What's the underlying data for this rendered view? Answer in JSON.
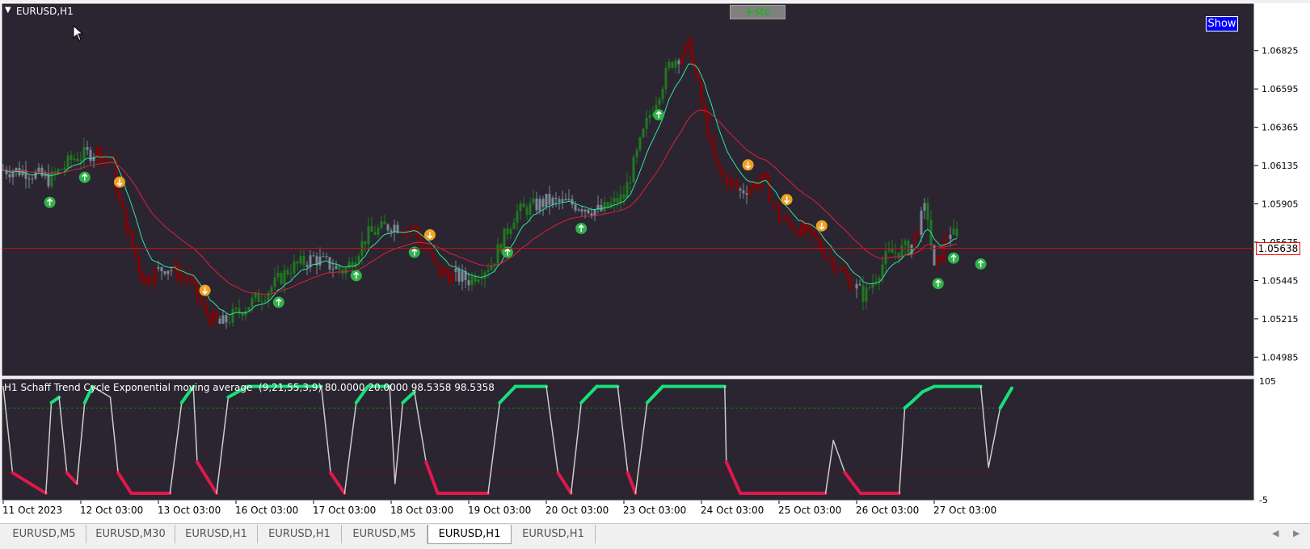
{
  "window": {
    "symbol_title": "EURUSD,H1",
    "stc_button_label": "+stc",
    "show_button_label": "Show",
    "indicator_label": "H1 Schaff Trend Cycle Exponential moving average  (9,21,55,3,9) 80.0000 20.0000 98.5358 98.5358",
    "current_price_label": "1.05638",
    "current_price": 1.05638
  },
  "colors": {
    "background": "#2a2530",
    "axis_area": "#ffffff",
    "bull_candle": "#1f7a1f",
    "bear_candle": "#8b0000",
    "neutral_candle": "#7c8796",
    "fast_ma": "#2ee6a0",
    "slow_ma": "#e0203c",
    "buy_arrow": "#2fb34a",
    "sell_arrow": "#f0a020",
    "price_line": "#c81414",
    "stc_up": "#18e07a",
    "stc_down": "#e0184c",
    "stc_neutral": "#cccccc",
    "level_80": "#1f7a1f",
    "level_20": "#8b0000"
  },
  "tabs": [
    {
      "label": "EURUSD,M5",
      "active": false
    },
    {
      "label": "EURUSD,M30",
      "active": false
    },
    {
      "label": "EURUSD,H1",
      "active": false
    },
    {
      "label": "EURUSD,H1",
      "active": false
    },
    {
      "label": "EURUSD,M5",
      "active": false
    },
    {
      "label": "EURUSD,H1",
      "active": true
    },
    {
      "label": "EURUSD,H1",
      "active": false
    }
  ],
  "chart_data": [
    {
      "type": "candlestick",
      "title": "EURUSD,H1",
      "y_ticks": [
        "1.06825",
        "1.06595",
        "1.06365",
        "1.06135",
        "1.05905",
        "1.05675",
        "1.05445",
        "1.05215",
        "1.04985"
      ],
      "ylim": [
        1.0488,
        1.071
      ],
      "x_ticks": [
        "11 Oct 2023",
        "12 Oct 03:00",
        "13 Oct 03:00",
        "16 Oct 03:00",
        "17 Oct 03:00",
        "18 Oct 03:00",
        "19 Oct 03:00",
        "20 Oct 03:00",
        "23 Oct 03:00",
        "24 Oct 03:00",
        "25 Oct 03:00",
        "26 Oct 03:00",
        "27 Oct 03:00"
      ],
      "close_path": [
        {
          "day": 0.0,
          "price": 1.0611
        },
        {
          "day": 0.3,
          "price": 1.061
        },
        {
          "day": 0.6,
          "price": 1.0605
        },
        {
          "day": 0.9,
          "price": 1.0618
        },
        {
          "day": 1.2,
          "price": 1.0622
        },
        {
          "day": 1.4,
          "price": 1.0618
        },
        {
          "day": 1.5,
          "price": 1.059
        },
        {
          "day": 1.8,
          "price": 1.0545
        },
        {
          "day": 2.1,
          "price": 1.0553
        },
        {
          "day": 2.4,
          "price": 1.0545
        },
        {
          "day": 2.6,
          "price": 1.0525
        },
        {
          "day": 2.8,
          "price": 1.0518
        },
        {
          "day": 3.1,
          "price": 1.0528
        },
        {
          "day": 3.4,
          "price": 1.0538
        },
        {
          "day": 3.7,
          "price": 1.0552
        },
        {
          "day": 4.0,
          "price": 1.0558
        },
        {
          "day": 4.4,
          "price": 1.055
        },
        {
          "day": 4.7,
          "price": 1.0572
        },
        {
          "day": 5.0,
          "price": 1.0578
        },
        {
          "day": 5.3,
          "price": 1.0575
        },
        {
          "day": 5.6,
          "price": 1.055
        },
        {
          "day": 6.0,
          "price": 1.0545
        },
        {
          "day": 6.3,
          "price": 1.0555
        },
        {
          "day": 6.6,
          "price": 1.0585
        },
        {
          "day": 7.0,
          "price": 1.0592
        },
        {
          "day": 7.4,
          "price": 1.059
        },
        {
          "day": 7.7,
          "price": 1.0586
        },
        {
          "day": 8.0,
          "price": 1.0595
        },
        {
          "day": 8.3,
          "price": 1.064
        },
        {
          "day": 8.6,
          "price": 1.0675
        },
        {
          "day": 8.85,
          "price": 1.0685
        },
        {
          "day": 9.0,
          "price": 1.065
        },
        {
          "day": 9.2,
          "price": 1.061
        },
        {
          "day": 9.5,
          "price": 1.0598
        },
        {
          "day": 9.8,
          "price": 1.0605
        },
        {
          "day": 10.0,
          "price": 1.0582
        },
        {
          "day": 10.4,
          "price": 1.0572
        },
        {
          "day": 10.8,
          "price": 1.055
        },
        {
          "day": 11.1,
          "price": 1.0535
        },
        {
          "day": 11.4,
          "price": 1.056
        },
        {
          "day": 11.7,
          "price": 1.0565
        },
        {
          "day": 11.9,
          "price": 1.059
        },
        {
          "day": 12.0,
          "price": 1.055
        },
        {
          "day": 12.2,
          "price": 1.0575
        },
        {
          "day": 12.3,
          "price": 1.0568
        }
      ],
      "sell_arrows": [
        1.5,
        2.6,
        5.5,
        9.6,
        10.1,
        10.55
      ],
      "buy_arrows": [
        0.6,
        1.05,
        3.55,
        4.55,
        5.3,
        6.5,
        7.45,
        8.45,
        12.05,
        12.25,
        12.6
      ]
    },
    {
      "type": "line",
      "title": "H1 Schaff Trend Cycle Exponential moving average",
      "y_ticks": [
        "105",
        "-5"
      ],
      "ylim": [
        -5,
        105
      ],
      "levels": [
        80,
        20
      ],
      "points": [
        {
          "day": 0.0,
          "stc": 100
        },
        {
          "day": 0.12,
          "stc": 20
        },
        {
          "day": 0.55,
          "stc": 1
        },
        {
          "day": 0.62,
          "stc": 85
        },
        {
          "day": 0.72,
          "stc": 90
        },
        {
          "day": 0.82,
          "stc": 20
        },
        {
          "day": 0.95,
          "stc": 10
        },
        {
          "day": 1.05,
          "stc": 85
        },
        {
          "day": 1.15,
          "stc": 100
        },
        {
          "day": 1.38,
          "stc": 90
        },
        {
          "day": 1.48,
          "stc": 20
        },
        {
          "day": 1.65,
          "stc": 1
        },
        {
          "day": 2.15,
          "stc": 1
        },
        {
          "day": 2.3,
          "stc": 85
        },
        {
          "day": 2.45,
          "stc": 100
        },
        {
          "day": 2.5,
          "stc": 30
        },
        {
          "day": 2.75,
          "stc": 1
        },
        {
          "day": 2.9,
          "stc": 90
        },
        {
          "day": 3.15,
          "stc": 100
        },
        {
          "day": 4.1,
          "stc": 100
        },
        {
          "day": 4.22,
          "stc": 20
        },
        {
          "day": 4.4,
          "stc": 1
        },
        {
          "day": 4.55,
          "stc": 85
        },
        {
          "day": 4.7,
          "stc": 100
        },
        {
          "day": 4.98,
          "stc": 100
        },
        {
          "day": 5.05,
          "stc": 10
        },
        {
          "day": 5.15,
          "stc": 85
        },
        {
          "day": 5.3,
          "stc": 95
        },
        {
          "day": 5.45,
          "stc": 30
        },
        {
          "day": 5.6,
          "stc": 1
        },
        {
          "day": 6.25,
          "stc": 1
        },
        {
          "day": 6.4,
          "stc": 85
        },
        {
          "day": 6.6,
          "stc": 100
        },
        {
          "day": 7.0,
          "stc": 100
        },
        {
          "day": 7.15,
          "stc": 20
        },
        {
          "day": 7.32,
          "stc": 1
        },
        {
          "day": 7.45,
          "stc": 85
        },
        {
          "day": 7.65,
          "stc": 100
        },
        {
          "day": 7.92,
          "stc": 100
        },
        {
          "day": 8.05,
          "stc": 20
        },
        {
          "day": 8.15,
          "stc": 1
        },
        {
          "day": 8.3,
          "stc": 85
        },
        {
          "day": 8.5,
          "stc": 100
        },
        {
          "day": 9.3,
          "stc": 100
        },
        {
          "day": 9.32,
          "stc": 30
        },
        {
          "day": 9.5,
          "stc": 1
        },
        {
          "day": 10.6,
          "stc": 1
        },
        {
          "day": 10.7,
          "stc": 50
        },
        {
          "day": 10.85,
          "stc": 20
        },
        {
          "day": 11.05,
          "stc": 1
        },
        {
          "day": 11.55,
          "stc": 1
        },
        {
          "day": 11.62,
          "stc": 80
        },
        {
          "day": 11.7,
          "stc": 85
        },
        {
          "day": 11.85,
          "stc": 95
        },
        {
          "day": 12.0,
          "stc": 100
        },
        {
          "day": 12.6,
          "stc": 100
        },
        {
          "day": 12.7,
          "stc": 25
        },
        {
          "day": 12.85,
          "stc": 80
        },
        {
          "day": 13.0,
          "stc": 98.5
        }
      ]
    }
  ]
}
